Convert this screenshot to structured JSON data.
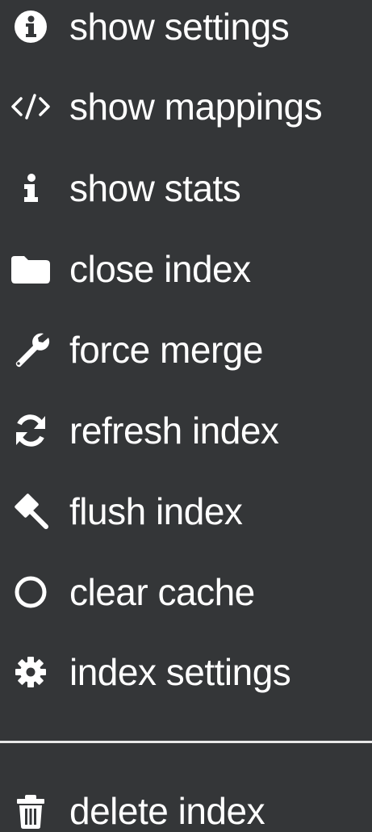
{
  "menu": {
    "items": [
      {
        "label": "show settings",
        "icon": "info-circle-icon"
      },
      {
        "label": "show mappings",
        "icon": "code-icon"
      },
      {
        "label": "show stats",
        "icon": "info-icon"
      },
      {
        "label": "close index",
        "icon": "folder-icon"
      },
      {
        "label": "force merge",
        "icon": "wrench-icon"
      },
      {
        "label": "refresh index",
        "icon": "refresh-icon"
      },
      {
        "label": "flush index",
        "icon": "gavel-icon"
      },
      {
        "label": "clear cache",
        "icon": "circle-outline-icon"
      },
      {
        "label": "index settings",
        "icon": "gear-icon"
      },
      {
        "label": "delete index",
        "icon": "trash-icon"
      }
    ]
  },
  "colors": {
    "background": "#343638",
    "text": "#ffffff",
    "divider": "#e8e8e8"
  }
}
